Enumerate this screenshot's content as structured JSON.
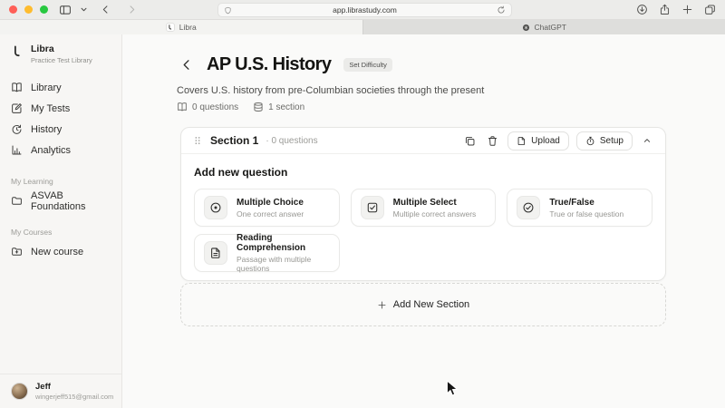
{
  "browser": {
    "url": "app.librastudy.com",
    "tabs": [
      {
        "label": "Libra"
      },
      {
        "label": "ChatGPT"
      }
    ]
  },
  "sidebar": {
    "app_name": "Libra",
    "app_subtitle": "Practice Test Library",
    "nav": [
      {
        "label": "Library"
      },
      {
        "label": "My Tests"
      },
      {
        "label": "History"
      },
      {
        "label": "Analytics"
      }
    ],
    "groups": [
      {
        "title": "My Learning",
        "item": "ASVAB Foundations"
      },
      {
        "title": "My Courses",
        "item": "New course"
      }
    ],
    "user": {
      "name": "Jeff",
      "email": "wingerjeff515@gmail.com"
    }
  },
  "main": {
    "title": "AP U.S. History",
    "badge": "Set Difficulty",
    "description": "Covers U.S. history from pre-Columbian societies through the present",
    "stats": [
      {
        "label": "0 questions"
      },
      {
        "label": "1 section"
      }
    ],
    "section": {
      "title": "Section 1",
      "meta": "· 0 questions",
      "upload": "Upload",
      "setup": "Setup",
      "add_question_heading": "Add new question",
      "question_types": [
        {
          "title": "Multiple Choice",
          "subtitle": "One correct answer"
        },
        {
          "title": "Multiple Select",
          "subtitle": "Multiple correct answers"
        },
        {
          "title": "True/False",
          "subtitle": "True or false question"
        },
        {
          "title": "Reading Comprehension",
          "subtitle": "Passage with multiple questions"
        }
      ]
    },
    "add_section_label": "Add New Section"
  },
  "colors": {
    "traffic_red": "#ff5f57",
    "traffic_yellow": "#febc2e",
    "traffic_green": "#28c840",
    "chrome_bg": "#ececea",
    "sidebar_bg": "#f7f6f4",
    "main_bg": "#fafaf9",
    "panel_bg": "#ffffff"
  }
}
